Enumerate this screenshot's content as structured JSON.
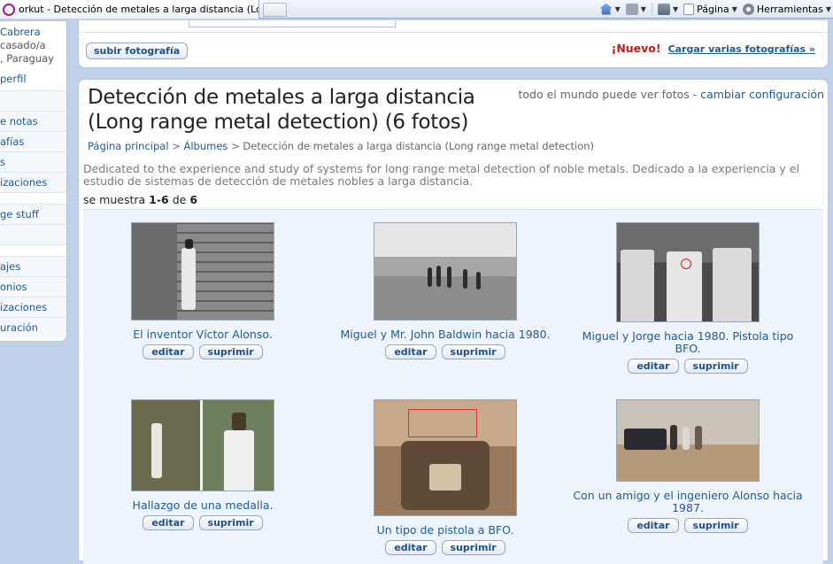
{
  "browser": {
    "tab_title": "orkut - Detección de metales a larga distancia (Long r...",
    "toolbar": {
      "page_label": "Página",
      "tools_label": "Herramientas"
    }
  },
  "sidebar": {
    "profile": {
      "name": "Cabrera",
      "line1": "casado/a",
      "line2": ", Paraguay"
    },
    "perfil_link": "perfil",
    "group1": [
      "",
      "e notas",
      "afías",
      "s",
      "izaciones"
    ],
    "group2": [
      "ge stuff",
      ""
    ],
    "group3": [
      "ajes",
      "onios",
      "izaciones",
      "uración"
    ]
  },
  "upload": {
    "button": "subir fotografía",
    "new_badge": "¡Nuevo!",
    "multi_link": "Cargar varias fotografías »"
  },
  "album": {
    "title": "Detección de metales a larga distancia (Long range metal detection) (6 fotos)",
    "privacy_text": "todo el mundo puede ver fotos - ",
    "privacy_link": "cambiar configuración",
    "breadcrumb": {
      "home": "Página principal",
      "sep": ">",
      "albums": "Álbumes",
      "current": "Detección de metales a larga distancia (Long range metal detection)"
    },
    "description": "Dedicated to the experience and study of systems for long range metal detection of noble metals. Dedicado a la experiencia y el estudio de sistemas de detección de metales nobles a larga distancia.",
    "count": {
      "prefix": "se muestra ",
      "range": "1-6",
      "of": " de ",
      "total": "6"
    },
    "edit_label": "editar",
    "delete_label": "suprimir",
    "photos": [
      {
        "caption": "El inventor Víctor Alonso."
      },
      {
        "caption": "Miguel y Mr. John Baldwin hacia 1980."
      },
      {
        "caption": "Miguel y Jorge hacia 1980. Pistola tipo BFO."
      },
      {
        "caption": "Hallazgo de una medalla."
      },
      {
        "caption": "Un tipo de pistola a BFO."
      },
      {
        "caption": "Con un amigo y el ingeniero Alonso hacia 1987."
      }
    ]
  },
  "colors": {
    "link": "#1e5a9a",
    "new_badge": "#c21a1a",
    "background": "#bfd0ea"
  }
}
